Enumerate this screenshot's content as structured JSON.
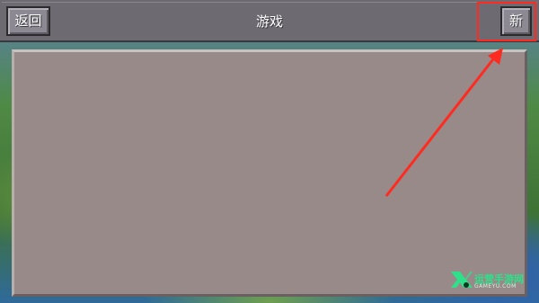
{
  "header": {
    "back_label": "返回",
    "title": "游戏",
    "new_label": "新"
  },
  "watermark": {
    "brand": "运营手游网",
    "site": "GAMEYU.COM"
  },
  "colors": {
    "annotation": "#ff2a20",
    "panel": "#978a88",
    "topbar": "#6e6a72"
  }
}
